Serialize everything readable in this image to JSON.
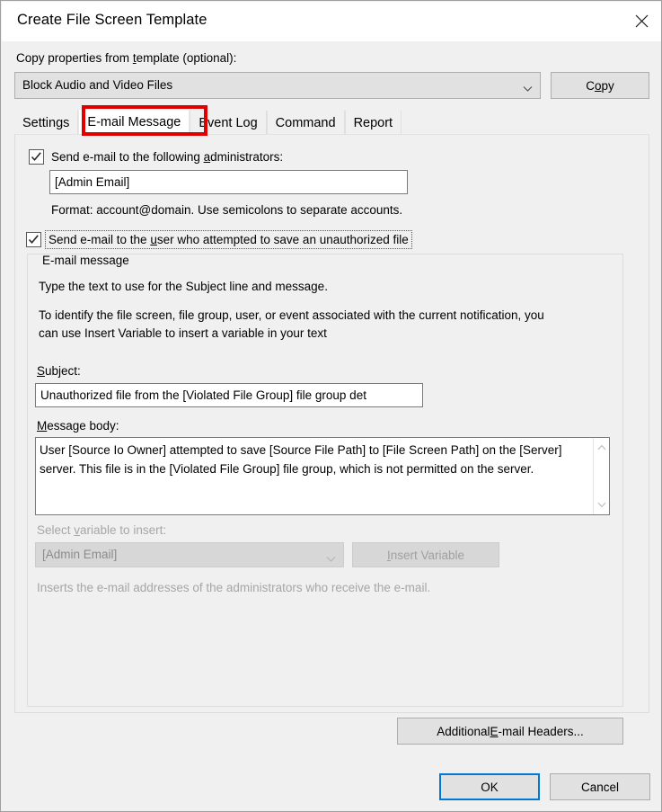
{
  "window": {
    "title": "Create File Screen Template",
    "close_icon": "close-icon"
  },
  "copy_properties": {
    "label": "Copy properties from template (optional):",
    "label_pre": "Copy properties from ",
    "label_accel": "t",
    "label_post": "emplate (optional):",
    "selected_template": "Block Audio and Video Files",
    "dropdown_icon": "chevron-down-icon",
    "copy_button": {
      "pre": "C",
      "accel": "o",
      "post": "py"
    }
  },
  "tabs": [
    {
      "label": "Settings",
      "active": false
    },
    {
      "label": "E-mail Message",
      "active": true
    },
    {
      "label": "Event Log",
      "active": false
    },
    {
      "label": "Command",
      "active": false
    },
    {
      "label": "Report",
      "active": false
    }
  ],
  "annotation": {
    "highlight_color": "#e00000",
    "highlighted_tab": "E-mail Message"
  },
  "email_tab": {
    "admin_checkbox": {
      "checked": true,
      "label_pre": "Send e-mail to the following ",
      "label_accel": "a",
      "label_post": "dministrators:"
    },
    "admin_email_value": "[Admin Email]",
    "format_hint": "Format: account@domain. Use semicolons to separate accounts.",
    "user_checkbox": {
      "checked": true,
      "focused": true,
      "label_pre": "Send e-mail to the ",
      "label_accel": "u",
      "label_post": "ser who attempted to save an unauthorized file"
    },
    "group": {
      "title": "E-mail message",
      "para1": "Type the text to use for the Subject line and message.",
      "para2": "To identify the file screen, file group, user, or event associated with the current notification, you can use Insert Variable to insert a variable in your text",
      "subject_label_pre": "",
      "subject_label_accel": "S",
      "subject_label_post": "ubject:",
      "subject_value": "Unauthorized file from the [Violated File Group] file group det",
      "message_label_pre": "",
      "message_label_accel": "M",
      "message_label_post": "essage body:",
      "message_value": "User [Source Io Owner] attempted to save [Source File Path] to [File Screen Path] on the [Server] server. This file is in the [Violated File Group] file group, which is not permitted on the server.",
      "scroll_up_icon": "chevron-up-icon",
      "scroll_down_icon": "chevron-down-icon",
      "select_variable_label_pre": "Select ",
      "select_variable_label_accel": "v",
      "select_variable_label_post": "ariable to insert:",
      "select_variable_value": "[Admin Email]",
      "select_variable_dropdown_icon": "chevron-down-icon",
      "insert_variable_button": {
        "pre": "",
        "accel": "I",
        "post": "nsert Variable"
      },
      "variable_description": "Inserts the e-mail addresses of the administrators who receive the e-mail.",
      "disabled": true
    },
    "additional_headers_button": {
      "pre": "Additional ",
      "accel": "E",
      "post": "-mail Headers..."
    }
  },
  "footer": {
    "ok_label": "OK",
    "cancel_label": "Cancel",
    "default_button": "OK"
  }
}
